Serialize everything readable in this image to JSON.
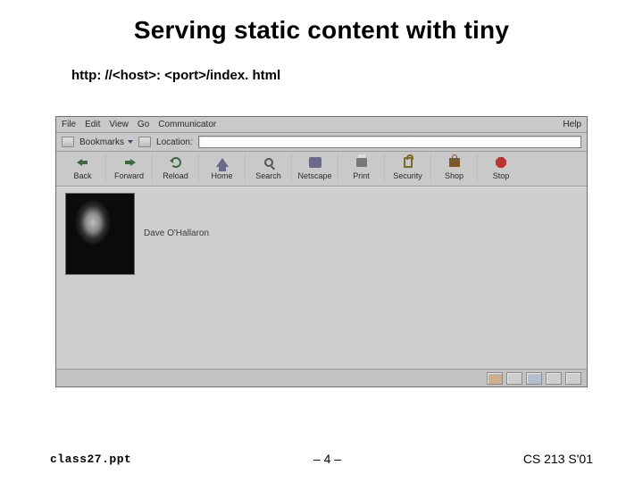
{
  "title": "Serving static content with tiny",
  "url_line": "http: //<host>: <port>/index. html",
  "menubar": {
    "items": [
      "File",
      "Edit",
      "View",
      "Go",
      "Communicator"
    ],
    "help": "Help"
  },
  "bookmark_row": {
    "bookmarks_label": "Bookmarks",
    "location_label": "Location:"
  },
  "toolbar": [
    {
      "label": "Back",
      "icon": "back-icon"
    },
    {
      "label": "Forward",
      "icon": "forward-icon"
    },
    {
      "label": "Reload",
      "icon": "reload-icon"
    },
    {
      "label": "Home",
      "icon": "home-icon"
    },
    {
      "label": "Search",
      "icon": "search-icon"
    },
    {
      "label": "Netscape",
      "icon": "netscape-icon"
    },
    {
      "label": "Print",
      "icon": "print-icon"
    },
    {
      "label": "Security",
      "icon": "security-icon"
    },
    {
      "label": "Shop",
      "icon": "shop-icon"
    },
    {
      "label": "Stop",
      "icon": "stop-icon"
    }
  ],
  "page": {
    "caption": "Dave O'Hallaron"
  },
  "footer": {
    "left": "class27.ppt",
    "mid": "– 4 –",
    "right": "CS 213 S'01"
  }
}
